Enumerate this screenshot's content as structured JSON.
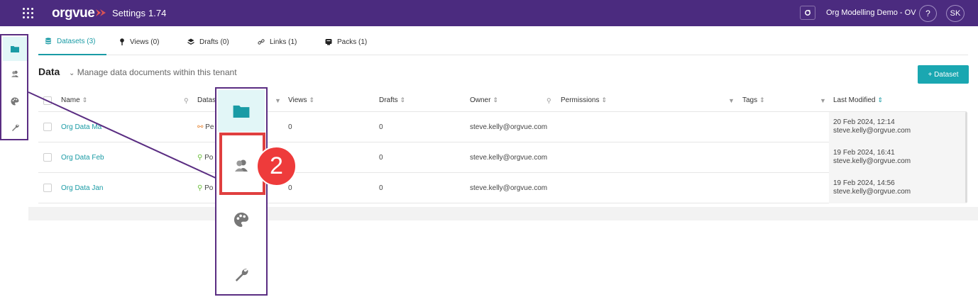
{
  "header": {
    "logo": "orgvue",
    "app_name": "Settings",
    "version": "1.74",
    "tenant": "Org Modelling Demo - OV",
    "help": "?",
    "user_initials": "SK",
    "brand_color": "#4b2b7f",
    "logo_mark_color": "#f05a4f"
  },
  "sidebar": {
    "items": [
      {
        "icon": "folder-icon",
        "active": true
      },
      {
        "icon": "users-icon",
        "active": false
      },
      {
        "icon": "palette-icon",
        "active": false
      },
      {
        "icon": "wrench-icon",
        "active": false
      }
    ]
  },
  "tabs": [
    {
      "label": "Datasets (3)",
      "icon": "database-icon",
      "active": true
    },
    {
      "label": "Views (0)",
      "icon": "pin-icon",
      "active": false
    },
    {
      "label": "Drafts (0)",
      "icon": "layers-icon",
      "active": false
    },
    {
      "label": "Links (1)",
      "icon": "link-icon",
      "active": false
    },
    {
      "label": "Packs (1)",
      "icon": "pack-icon",
      "active": false
    }
  ],
  "section": {
    "title": "Data",
    "subtitle": "Manage data documents within this tenant",
    "add_button": "+ Dataset"
  },
  "table": {
    "columns": {
      "name": "Name",
      "dataset_type": "Datas",
      "views": "Views",
      "drafts": "Drafts",
      "owner": "Owner",
      "permissions": "Permissions",
      "tags": "Tags",
      "last_modified": "Last Modified"
    },
    "rows": [
      {
        "name": "Org Data Ma",
        "type": "Pe",
        "views": "0",
        "drafts": "0",
        "owner": "steve.kelly@orgvue.com",
        "modified_date": "20 Feb 2024, 12:14",
        "modified_by": "steve.kelly@orgvue.com"
      },
      {
        "name": "Org Data Feb",
        "type": "Po",
        "views": "",
        "drafts": "0",
        "owner": "steve.kelly@orgvue.com",
        "modified_date": "19 Feb 2024, 16:41",
        "modified_by": "steve.kelly@orgvue.com"
      },
      {
        "name": "Org Data Jan",
        "type": "Po",
        "views": "0",
        "drafts": "0",
        "owner": "steve.kelly@orgvue.com",
        "modified_date": "19 Feb 2024, 14:56",
        "modified_by": "steve.kelly@orgvue.com"
      }
    ]
  },
  "callout": {
    "step_number": "2",
    "accent": "#1aa7b1",
    "frame_color": "#5a2d82",
    "highlight_color": "#e03f3f"
  }
}
